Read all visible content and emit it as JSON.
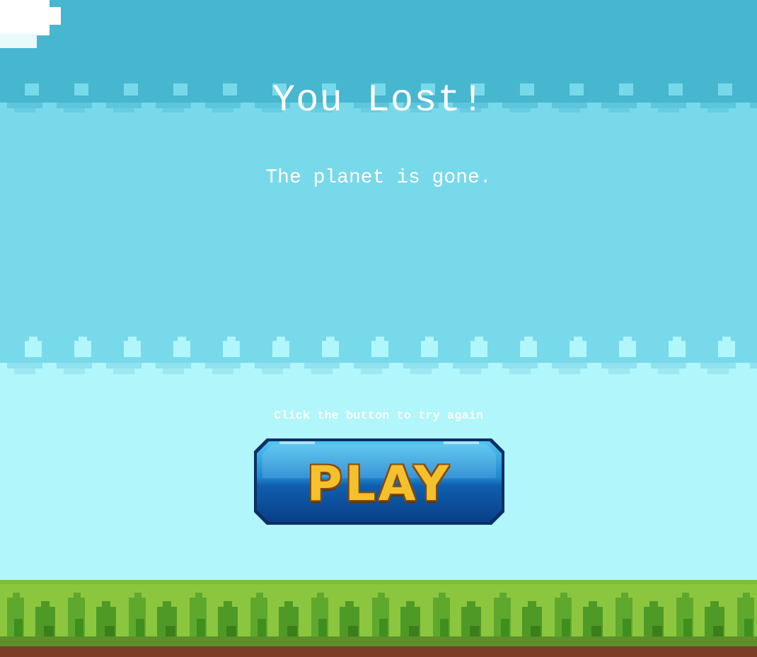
{
  "screen": {
    "title": "You Lost!",
    "subtitle": "The planet is gone.",
    "hint": "Click the button to try again",
    "play_button": {
      "label": "PLAY"
    }
  },
  "colors": {
    "sky_top": "#47b6cf",
    "sky_mid": "#78d9ea",
    "sky_low": "#b0f6fa",
    "grass_light": "#8cc63f",
    "grass_dark": "#3f8f1e",
    "dirt": "#7a3d28",
    "button_blue": "#1a6fc0",
    "button_text": "#f4c12e"
  }
}
